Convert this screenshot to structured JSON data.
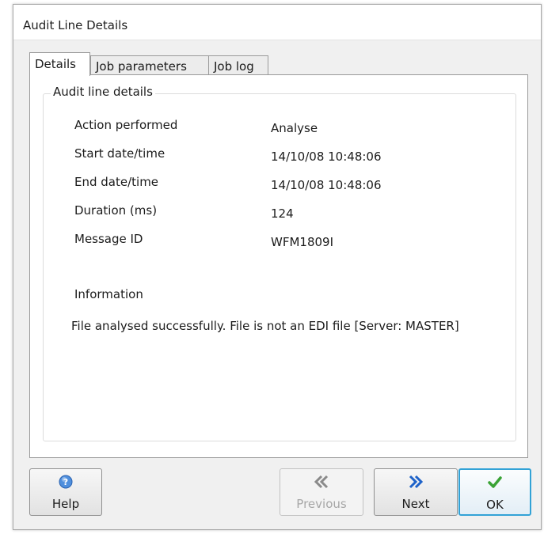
{
  "window": {
    "title": "Audit Line Details"
  },
  "tabs": [
    {
      "label": "Details",
      "active": true
    },
    {
      "label": "Job parameters",
      "active": false
    },
    {
      "label": "Job log",
      "active": false
    }
  ],
  "details": {
    "group_title": "Audit line details",
    "rows": [
      {
        "label": "Action performed",
        "value": "Analyse"
      },
      {
        "label": "Start date/time",
        "value": "14/10/08 10:48:06"
      },
      {
        "label": "End date/time",
        "value": "14/10/08 10:48:06"
      },
      {
        "label": "Duration (ms)",
        "value": "124"
      },
      {
        "label": "Message ID",
        "value": "WFM1809I"
      }
    ],
    "information_label": "Information",
    "information_text": "File analysed successfully. File is not an EDI file  [Server: MASTER]"
  },
  "buttons": {
    "help": {
      "label": "Help",
      "icon": "help-icon"
    },
    "previous": {
      "label": "Previous",
      "icon": "double-chevron-left-icon",
      "enabled": false
    },
    "next": {
      "label": "Next",
      "icon": "double-chevron-right-icon"
    },
    "ok": {
      "label": "OK",
      "icon": "checkmark-icon"
    }
  },
  "colors": {
    "accent": "#32a2d6",
    "check_green": "#3aa335",
    "next_blue": "#1f63c9"
  }
}
